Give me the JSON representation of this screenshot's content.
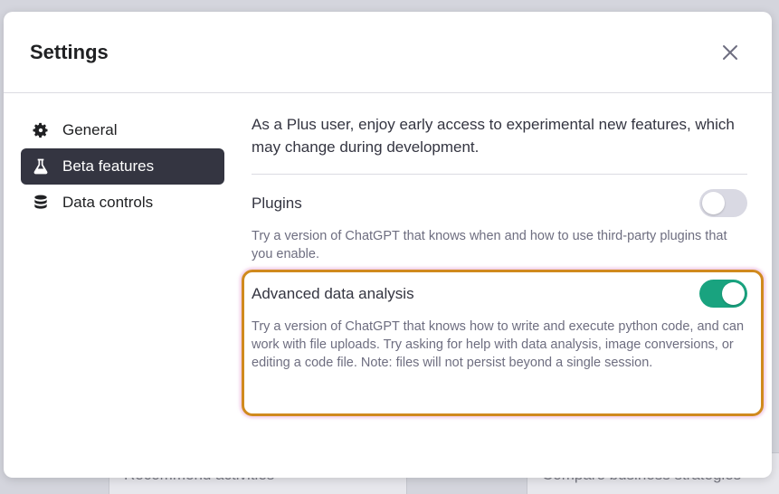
{
  "background": {
    "card_left": "Recommend activities",
    "card_right": "Compare business strategies"
  },
  "modal": {
    "title": "Settings",
    "close_icon": "close-icon"
  },
  "sidebar": {
    "items": [
      {
        "label": "General",
        "icon": "gear-icon",
        "active": false
      },
      {
        "label": "Beta features",
        "icon": "flask-icon",
        "active": true
      },
      {
        "label": "Data controls",
        "icon": "database-icon",
        "active": false
      }
    ]
  },
  "content": {
    "intro": "As a Plus user, enjoy early access to experimental new features, which may change during development.",
    "features": [
      {
        "name": "Plugins",
        "description": "Try a version of ChatGPT that knows when and how to use third-party plugins that you enable.",
        "enabled": false
      },
      {
        "name": "Advanced data analysis",
        "description": "Try a version of ChatGPT that knows how to write and execute python code, and can work with file uploads. Try asking for help with data analysis, image conversions, or editing a code file. Note: files will not persist beyond a single session.",
        "enabled": true
      }
    ]
  },
  "colors": {
    "active_nav_bg": "#343541",
    "toggle_on": "#19a37f",
    "toggle_off": "#d9d9e3",
    "highlight_border": "#d08a1e"
  }
}
